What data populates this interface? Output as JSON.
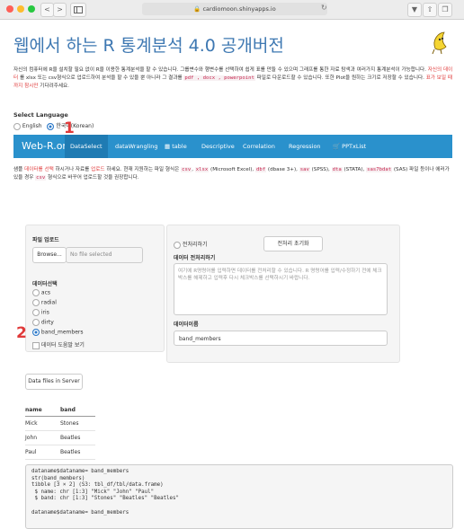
{
  "browser": {
    "url": "cardiomoon.shinyapps.io",
    "nav_back": "<",
    "nav_forward": ">"
  },
  "page": {
    "title": "웹에서 하는 R 통계분석 4.0 공개버전",
    "intro_1": "자신의 컴퓨터에 R을 설치할 필요 없이 R을 이용한 통계분석을 할 수 있습니다. 그룹변수와 행변수를 선택하여 쉽게 표를 만들 수 있으며 그래프를 통한 자료 탐색과 여러가지 통계분석이 가능합니다.",
    "intro_2": "자신의 데이터",
    "intro_3": "를 xlsx 또는 csv형식으로 업로드하여 분석을 할 수 있을 뿐 아니라 그 결과를",
    "intro_fmt": "pdf , docx , powerpoint",
    "intro_4": "파일로 다운로드할 수 있습니다. 또한 Plot을 원하는 크기로 저장할 수 있습니다.",
    "intro_5": "표가 보일 때까지 참시만",
    "intro_6": "기다려주세요."
  },
  "language": {
    "label": "Select Language",
    "options": [
      "English",
      "한국어(Korean)"
    ],
    "selected": "한국어(Korean)"
  },
  "nav": {
    "brand": "Web-R.org",
    "items": [
      "DataSelect",
      "dataWrangling",
      "table",
      "Descriptive",
      "Correlation",
      "Regression",
      "PPTxList"
    ],
    "active": "DataSelect"
  },
  "note": {
    "p1": "샘플",
    "p2": "데이터를 선택",
    "p3": "하시거나 자료를",
    "p4": "업로드",
    "p5": "하세요. 현재 지원하는 파일 형식은",
    "f1": "csv",
    "f2": "xlsx",
    "p6": "(Microsoft Excel),",
    "f3": "dbf",
    "p7": "(dbase 3+),",
    "f4": "sav",
    "p8": "(SPSS),",
    "f5": "dta",
    "p9": "(STATA),",
    "f6": "sas7bdat",
    "p10": "(SAS) 파일 등이나 에러가 있을 경우",
    "f7": "csv",
    "p11": "형식으로 바꾸어 업로드할 것을 권장합니다."
  },
  "upload": {
    "label": "파일 업로드",
    "browse": "Browse...",
    "no_file": "No file selected"
  },
  "dataset": {
    "label": "데이터선택",
    "options": [
      "acs",
      "radial",
      "iris",
      "dirty",
      "band_members"
    ],
    "selected": "band_members",
    "editor_label": "데이터 도움말 보기"
  },
  "preprocess": {
    "checkbox": "전처리하기",
    "reset_button": "전처리 초기화",
    "label": "데이터 전처리하기",
    "placeholder": "여기에 R명령어를 입력하면 데이터를 전처리할 수 있습니다. R 명령어를 입력/수정하기 전에 체크박스를 해제하고 입력후 다시 체크박스를 선택하시기 바랍니다."
  },
  "dataname": {
    "label": "데이터이름",
    "value": "band_members"
  },
  "datafiles_button": "Data files in Server",
  "annotations": [
    "1",
    "2"
  ],
  "table": {
    "headers": [
      "name",
      "band"
    ],
    "rows": [
      [
        "Mick",
        "Stones"
      ],
      [
        "John",
        "Beatles"
      ],
      [
        "Paul",
        "Beatles"
      ]
    ]
  },
  "code_output": "dataname$dataname= band_members\nstr(band_members)\ntibble [3 × 2] (S3: tbl_df/tbl/data.frame)\n $ name: chr [1:3] \"Mick\" \"John\" \"Paul\"\n $ band: chr [1:3] \"Stones\" \"Beatles\" \"Beatles\"\n\ndataname$dataname= band_members",
  "colors": {
    "navbar": "#2a91cc",
    "title": "#3e78b2",
    "highlight": "#e03a3a"
  }
}
